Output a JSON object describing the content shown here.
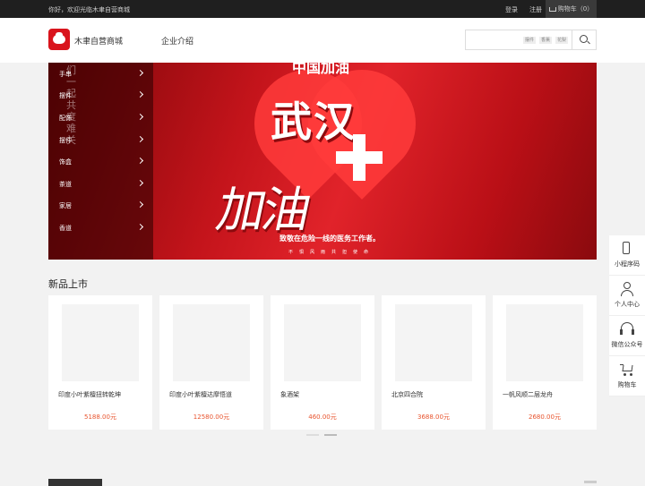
{
  "topbar": {
    "welcome": "你好，欢迎光临木聿自营商城",
    "login": "登录",
    "register": "注册",
    "cart": "购物车（0）"
  },
  "header": {
    "brand": "木聿自营商城",
    "nav": [
      "企业介绍"
    ],
    "search": {
      "value": "",
      "placeholder": "",
      "tags": [
        "摆件",
        "香薰",
        "花梨"
      ]
    }
  },
  "banner": {
    "top_text": "中国加油",
    "main_text": "武汉",
    "slogan": "加油",
    "headline": "致敬在危险一线的医务工作者。",
    "subline": "不惧风雨共担使命"
  },
  "category": {
    "overlay_text": "们一起共度难关",
    "items": [
      "手串",
      "摆件",
      "配饰",
      "摆件",
      "饰盒",
      "茶道",
      "家居",
      "香道"
    ]
  },
  "new_products": {
    "title": "新品上市",
    "items": [
      {
        "name": "印度小叶紫檀扭转乾坤",
        "price": "5188.00元"
      },
      {
        "name": "印度小叶紫檀达摩悟道",
        "price": "12580.00元"
      },
      {
        "name": "象酒架",
        "price": "460.00元"
      },
      {
        "name": "北京四合院",
        "price": "3688.00元"
      },
      {
        "name": "一帆风顺二层龙舟",
        "price": "2680.00元"
      }
    ],
    "pager_active": 1,
    "pager_count": 2
  },
  "sidebar": {
    "items": [
      {
        "label": "小程序码",
        "icon": "phone-icon"
      },
      {
        "label": "个人中心",
        "icon": "user-icon"
      },
      {
        "label": "微信公众号",
        "icon": "headset-icon"
      },
      {
        "label": "购物车",
        "icon": "cart-icon"
      }
    ]
  },
  "colors": {
    "accent": "#d9141c",
    "price": "#e8542e",
    "topbar": "#1f1f1f"
  }
}
